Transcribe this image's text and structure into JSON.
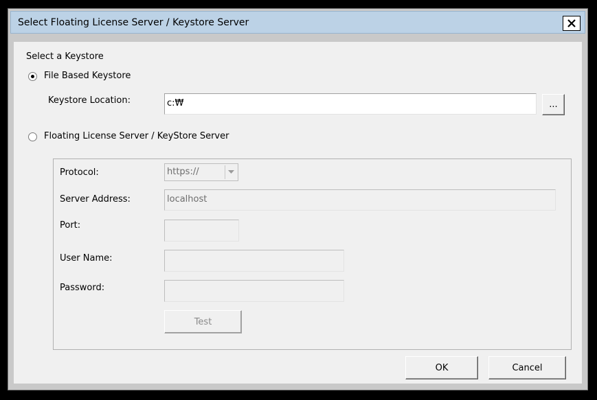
{
  "window": {
    "title": "Select Floating License Server / Keystore Server",
    "close_glyph": "✕"
  },
  "keystore": {
    "section_label": "Select a Keystore",
    "file_option_label": "File Based Keystore",
    "file_option_selected": true,
    "location_label": "Keystore Location:",
    "location_value": "c:₩",
    "browse_label": "..."
  },
  "server": {
    "option_label": "Floating License Server / KeyStore Server",
    "option_selected": false,
    "protocol_label": "Protocol:",
    "protocol_value": "https://",
    "address_label": "Server Address:",
    "address_value": "localhost",
    "port_label": "Port:",
    "port_value": "",
    "username_label": "User Name:",
    "username_value": "",
    "password_label": "Password:",
    "password_value": "",
    "test_label": "Test"
  },
  "footer": {
    "ok_label": "OK",
    "cancel_label": "Cancel"
  },
  "colors": {
    "titlebar": "#bcd2e6",
    "dialog_bg": "#f0f0f0",
    "frame": "#c9c9c9"
  },
  "icons": {
    "close": "close-icon",
    "dropdown": "chevron-down-icon"
  }
}
